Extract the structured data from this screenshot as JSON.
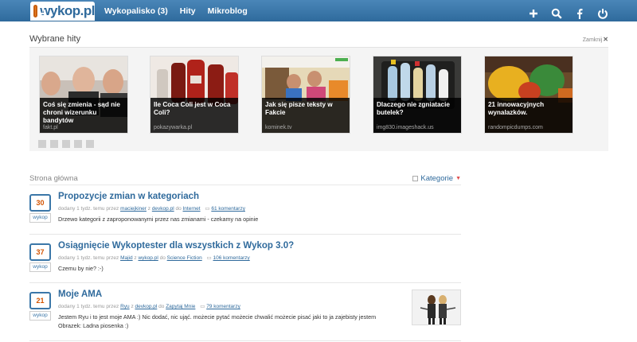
{
  "header": {
    "logo_text": "wykop.pl",
    "nav": [
      "Wykopalisko (3)",
      "Hity",
      "Mikroblog"
    ],
    "icons": [
      "plus-icon",
      "search-icon",
      "facebook-icon",
      "power-icon"
    ]
  },
  "hits": {
    "title": "Wybrane hity",
    "close_label": "Zamknij",
    "items": [
      {
        "title": "Coś się zmienia - sąd nie chroni wizerunku bandytów",
        "source": "fakt.pl"
      },
      {
        "title": "Ile Coca Coli jest w Coca Coli?",
        "source": "pokazywarka.pl"
      },
      {
        "title": "Jak się pisze teksty w Fakcie",
        "source": "kominek.tv"
      },
      {
        "title": "Dlaczego nie zgniatacie butelek?",
        "source": "img830.imageshack.us"
      },
      {
        "title": "21 innowacyjnych wynalazków.",
        "source": "randompicdumps.com"
      }
    ]
  },
  "main": {
    "title": "Strona główna",
    "category_label": "Kategorie",
    "vote_label": "wykop",
    "entries": [
      {
        "votes": "30",
        "title": "Propozycje zmian w kategoriach",
        "meta_prefix": "dodany 1 tydz. temu przez",
        "author": "maciejkiner",
        "from_word": "z",
        "domain": "devkop.pl",
        "to_word": "do",
        "category": "Internet",
        "comments": "61 komentarzy",
        "description": "Drzewo kategorii z zaproponowanymi przez nas zmianami - czekamy na opinie"
      },
      {
        "votes": "37",
        "title": "Osiągnięcie Wykoptester dla wszystkich z Wykop 3.0?",
        "meta_prefix": "dodany 1 tydz. temu przez",
        "author": "Majid",
        "from_word": "z",
        "domain": "wykop.pl",
        "to_word": "do",
        "category": "Science Fiction",
        "comments": "106 komentarzy",
        "description": "Czemu by nie? :-)"
      },
      {
        "votes": "21",
        "title": "Moje AMA",
        "meta_prefix": "dodany 1 tydz. temu przez",
        "author": "Ryu",
        "from_word": "z",
        "domain": "devkop.pl",
        "to_word": "do",
        "category": "Zapytaj Mnie",
        "comments": "79 komentarzy",
        "description": "Jestem Ryu i to jest moje AMA :) Nic dodać, nic ująć. możecie pytać możecie chwalić możecie pisać jaki to ja zajebisty jestem Obrazek: Ladna piosenka :)"
      }
    ]
  },
  "colors": {
    "topbar": "#3b77a8",
    "link": "#2f6a9c",
    "vote_count": "#d35400"
  }
}
